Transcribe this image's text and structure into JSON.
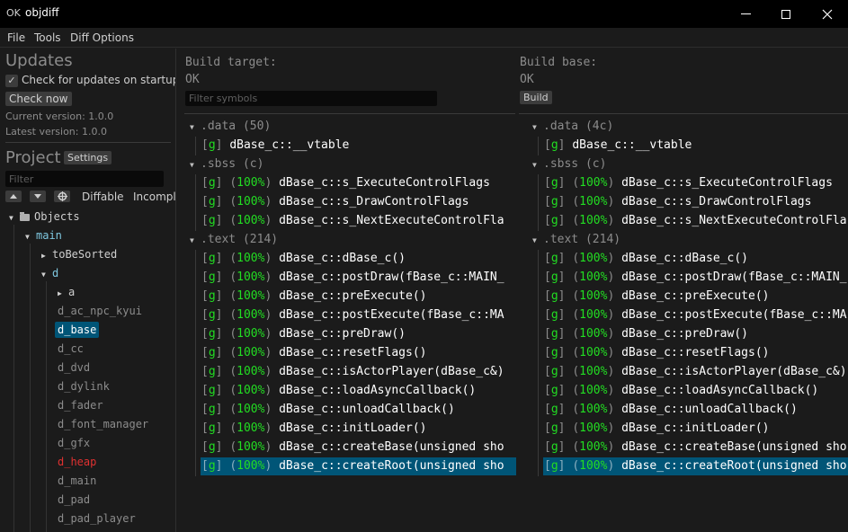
{
  "window": {
    "status_prefix": "OK",
    "title": "objdiff",
    "controls": {
      "minimize": "minimize",
      "maximize": "maximize",
      "close": "close"
    }
  },
  "menubar": {
    "items": [
      {
        "label": "File"
      },
      {
        "label": "Tools"
      },
      {
        "label": "Diff Options"
      }
    ]
  },
  "sidebar": {
    "updates": {
      "heading": "Updates",
      "check_on_startup_label": "Check for updates on startup",
      "check_on_startup_checked": true,
      "check_now_label": "Check now",
      "current_version": "Current version: 1.0.0",
      "latest_version": "Latest version: 1.0.0"
    },
    "project": {
      "heading": "Project",
      "settings_label": "Settings",
      "filter_placeholder": "Filter",
      "filter_value": "",
      "toggles": [
        "Diffable",
        "Incomple"
      ],
      "icon_buttons": [
        "collapse-up",
        "expand-down",
        "locate-target"
      ]
    },
    "tree": [
      {
        "label": "Objects",
        "type": "root",
        "expanded": true
      },
      {
        "label": "main",
        "type": "dir",
        "expanded": true
      },
      {
        "label": "toBeSorted",
        "type": "dir-collapsed",
        "expanded": false
      },
      {
        "label": "d",
        "type": "dir",
        "expanded": true
      },
      {
        "label": "a",
        "type": "dir-collapsed",
        "expanded": false
      },
      {
        "label": "d_ac_npc_kyui",
        "type": "file"
      },
      {
        "label": "d_base",
        "type": "file",
        "selected": true
      },
      {
        "label": "d_cc",
        "type": "file"
      },
      {
        "label": "d_dvd",
        "type": "file"
      },
      {
        "label": "d_dylink",
        "type": "file"
      },
      {
        "label": "d_fader",
        "type": "file"
      },
      {
        "label": "d_font_manager",
        "type": "file"
      },
      {
        "label": "d_gfx",
        "type": "file"
      },
      {
        "label": "d_heap",
        "type": "file",
        "status": "error"
      },
      {
        "label": "d_main",
        "type": "file"
      },
      {
        "label": "d_pad",
        "type": "file"
      },
      {
        "label": "d_pad_player",
        "type": "file"
      }
    ]
  },
  "target": {
    "heading": "Build target:",
    "status": "OK",
    "filter_placeholder": "Filter symbols",
    "filter_value": "",
    "sections": [
      {
        "name": ".data (50)",
        "symbols": [
          {
            "flag": "g",
            "percent": null,
            "name": "dBase_c::__vtable"
          }
        ]
      },
      {
        "name": ".sbss (c)",
        "symbols": [
          {
            "flag": "g",
            "percent": "100%",
            "name": "dBase_c::s_ExecuteControlFlags"
          },
          {
            "flag": "g",
            "percent": "100%",
            "name": "dBase_c::s_DrawControlFlags"
          },
          {
            "flag": "g",
            "percent": "100%",
            "name": "dBase_c::s_NextExecuteControlFla"
          }
        ]
      },
      {
        "name": ".text (214)",
        "symbols": [
          {
            "flag": "g",
            "percent": "100%",
            "name": "dBase_c::dBase_c()"
          },
          {
            "flag": "g",
            "percent": "100%",
            "name": "dBase_c::postDraw(fBase_c::MAIN_"
          },
          {
            "flag": "g",
            "percent": "100%",
            "name": "dBase_c::preExecute()"
          },
          {
            "flag": "g",
            "percent": "100%",
            "name": "dBase_c::postExecute(fBase_c::MA"
          },
          {
            "flag": "g",
            "percent": "100%",
            "name": "dBase_c::preDraw()"
          },
          {
            "flag": "g",
            "percent": "100%",
            "name": "dBase_c::resetFlags()"
          },
          {
            "flag": "g",
            "percent": "100%",
            "name": "dBase_c::isActorPlayer(dBase_c&)"
          },
          {
            "flag": "g",
            "percent": "100%",
            "name": "dBase_c::loadAsyncCallback()"
          },
          {
            "flag": "g",
            "percent": "100%",
            "name": "dBase_c::unloadCallback()"
          },
          {
            "flag": "g",
            "percent": "100%",
            "name": "dBase_c::initLoader()"
          },
          {
            "flag": "g",
            "percent": "100%",
            "name": "dBase_c::createBase(unsigned sho"
          },
          {
            "flag": "g",
            "percent": "100%",
            "name": "dBase_c::createRoot(unsigned sho",
            "selected": true
          }
        ]
      }
    ]
  },
  "base": {
    "heading": "Build base:",
    "status": "OK",
    "build_label": "Build",
    "sections": [
      {
        "name": ".data (4c)",
        "symbols": [
          {
            "flag": "g",
            "percent": null,
            "name": "dBase_c::__vtable"
          }
        ]
      },
      {
        "name": ".sbss (c)",
        "symbols": [
          {
            "flag": "g",
            "percent": "100%",
            "name": "dBase_c::s_ExecuteControlFlags"
          },
          {
            "flag": "g",
            "percent": "100%",
            "name": "dBase_c::s_DrawControlFlags"
          },
          {
            "flag": "g",
            "percent": "100%",
            "name": "dBase_c::s_NextExecuteControlFla"
          }
        ]
      },
      {
        "name": ".text (214)",
        "symbols": [
          {
            "flag": "g",
            "percent": "100%",
            "name": "dBase_c::dBase_c()"
          },
          {
            "flag": "g",
            "percent": "100%",
            "name": "dBase_c::postDraw(fBase_c::MAIN_"
          },
          {
            "flag": "g",
            "percent": "100%",
            "name": "dBase_c::preExecute()"
          },
          {
            "flag": "g",
            "percent": "100%",
            "name": "dBase_c::postExecute(fBase_c::MA"
          },
          {
            "flag": "g",
            "percent": "100%",
            "name": "dBase_c::preDraw()"
          },
          {
            "flag": "g",
            "percent": "100%",
            "name": "dBase_c::resetFlags()"
          },
          {
            "flag": "g",
            "percent": "100%",
            "name": "dBase_c::isActorPlayer(dBase_c&)"
          },
          {
            "flag": "g",
            "percent": "100%",
            "name": "dBase_c::loadAsyncCallback()"
          },
          {
            "flag": "g",
            "percent": "100%",
            "name": "dBase_c::unloadCallback()"
          },
          {
            "flag": "g",
            "percent": "100%",
            "name": "dBase_c::initLoader()"
          },
          {
            "flag": "g",
            "percent": "100%",
            "name": "dBase_c::createBase(unsigned sho"
          },
          {
            "flag": "g",
            "percent": "100%",
            "name": "dBase_c::createRoot(unsigned sho",
            "selected": true
          }
        ]
      }
    ]
  },
  "colors": {
    "match_green": "#22dd22",
    "selection": "#005577",
    "error_red": "#e03131",
    "dir_blue": "#7fc8e0"
  }
}
